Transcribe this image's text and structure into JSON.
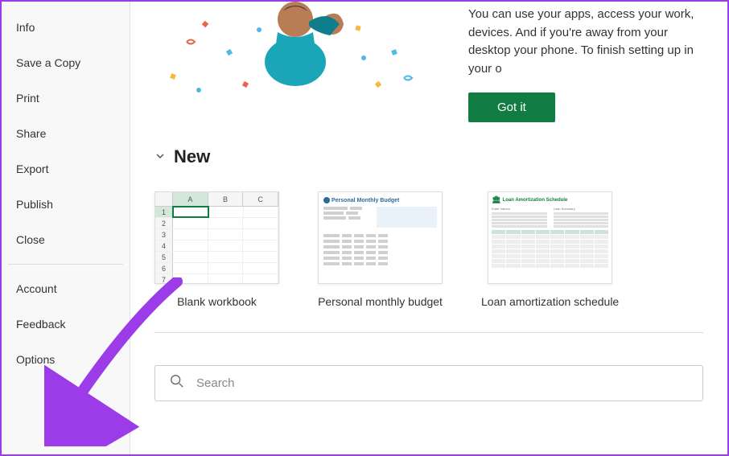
{
  "sidebar": {
    "items_top": [
      {
        "label": "Info"
      },
      {
        "label": "Save a Copy"
      },
      {
        "label": "Print"
      },
      {
        "label": "Share"
      },
      {
        "label": "Export"
      },
      {
        "label": "Publish"
      },
      {
        "label": "Close"
      }
    ],
    "items_bottom": [
      {
        "label": "Account"
      },
      {
        "label": "Feedback"
      },
      {
        "label": "Options"
      }
    ]
  },
  "banner": {
    "text": "You can use your apps, access your work, devices. And if you're away from your desktop your phone. To finish setting up in your o",
    "button": "Got it"
  },
  "section_new": {
    "title": "New"
  },
  "templates": [
    {
      "label": "Blank workbook"
    },
    {
      "label": "Personal monthly budget"
    },
    {
      "label": "Loan amortization schedule"
    }
  ],
  "thumb_blank": {
    "cols": [
      "A",
      "B",
      "C"
    ],
    "rows": [
      "1",
      "2",
      "3",
      "4",
      "5",
      "6",
      "7"
    ]
  },
  "thumb_budget_title": "Personal Monthly Budget",
  "thumb_loan": {
    "title": "Loan Amortization Schedule",
    "box1": "Enter Values",
    "box2": "Loan Summary"
  },
  "search": {
    "placeholder": "Search"
  },
  "colors": {
    "accent": "#107c41",
    "arrow": "#9b3ce8"
  }
}
